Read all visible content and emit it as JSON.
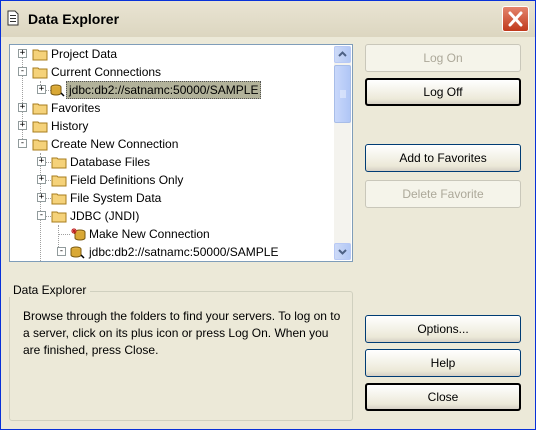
{
  "window": {
    "title": "Data Explorer"
  },
  "tree": {
    "nodes": [
      {
        "label": "Project Data",
        "expander": "+",
        "icon": "folder-icon"
      },
      {
        "label": "Current Connections",
        "expander": "-",
        "icon": "folder-icon"
      },
      {
        "label": "jdbc:db2://satnamc:50000/SAMPLE",
        "expander": "+",
        "icon": "database-connection-icon",
        "selected": true
      },
      {
        "label": "Favorites",
        "expander": "+",
        "icon": "folder-icon"
      },
      {
        "label": "History",
        "expander": "+",
        "icon": "folder-icon"
      },
      {
        "label": "Create New Connection",
        "expander": "-",
        "icon": "folder-icon"
      },
      {
        "label": "Database Files",
        "expander": "+",
        "icon": "folder-icon"
      },
      {
        "label": "Field Definitions Only",
        "expander": "+",
        "icon": "folder-icon"
      },
      {
        "label": "File System Data",
        "expander": "+",
        "icon": "folder-icon"
      },
      {
        "label": "JDBC (JNDI)",
        "expander": "-",
        "icon": "folder-icon"
      },
      {
        "label": "Make New Connection",
        "expander": "",
        "icon": "new-connection-icon"
      },
      {
        "label": "jdbc:db2://satnamc:50000/SAMPLE",
        "expander": "-",
        "icon": "database-connection-icon"
      }
    ]
  },
  "buttons": {
    "log_on": "Log On",
    "log_off": "Log Off",
    "add_favorites": "Add to Favorites",
    "delete_favorite": "Delete Favorite",
    "options": "Options...",
    "help": "Help",
    "close": "Close"
  },
  "info": {
    "title": "Data Explorer",
    "text": "Browse through the folders to find your servers.  To log on to a server, click on its plus icon or press Log On. When you are finished, press Close."
  },
  "colors": {
    "title_bar": "#dcd6c0",
    "close_button": "#c0391b",
    "selection": "#b2b29a",
    "scroll": "#b3c8f5"
  }
}
